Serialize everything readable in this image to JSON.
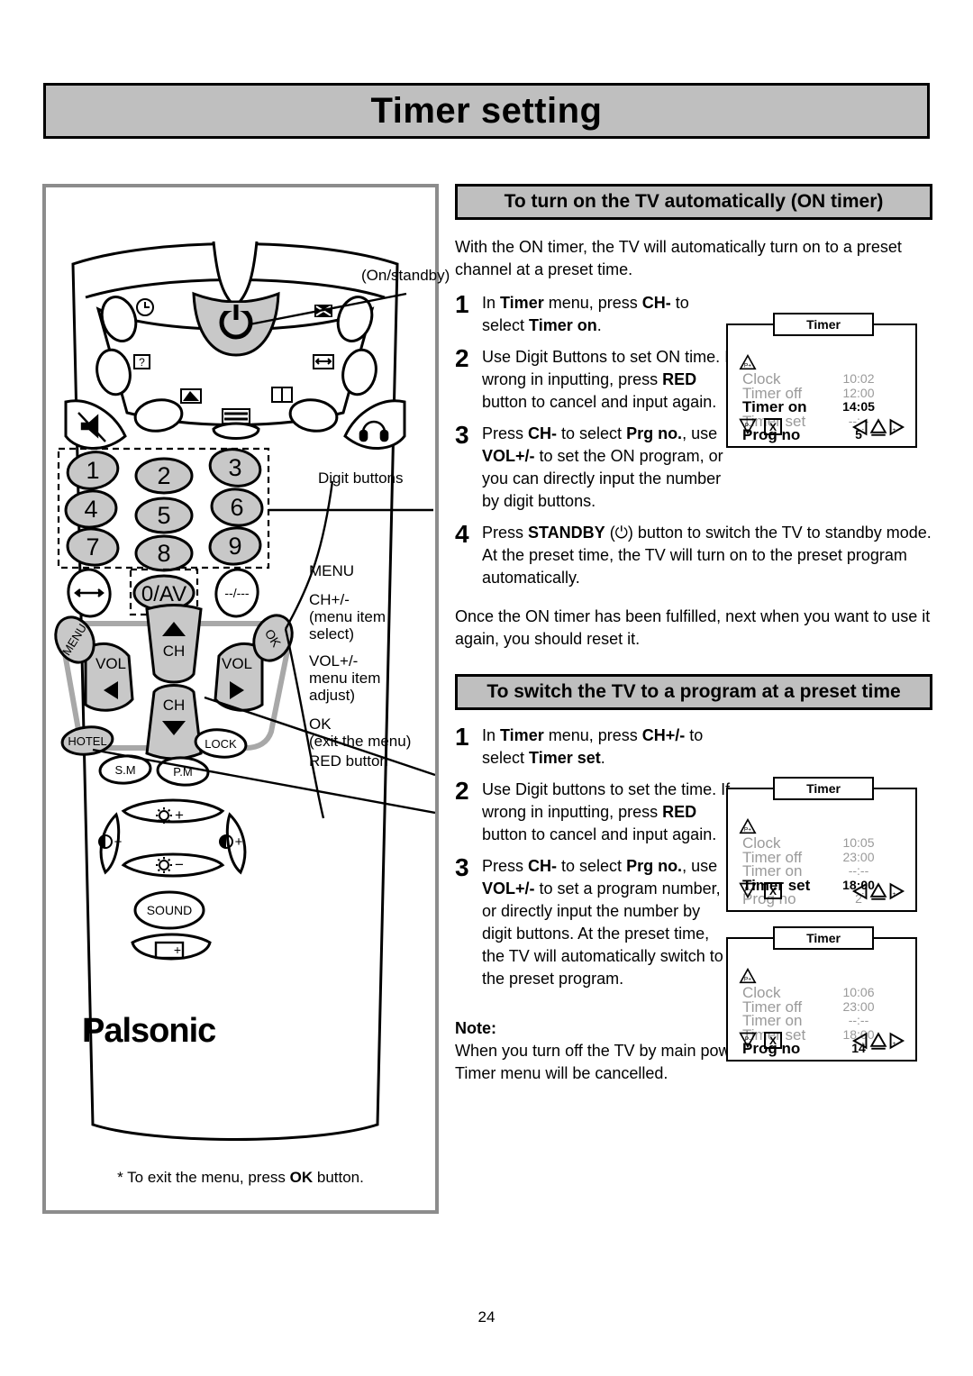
{
  "page": {
    "title": "Timer setting",
    "number": "24"
  },
  "left_panel": {
    "callouts": {
      "on_standby": "(On/standby)",
      "digit_buttons": "Digit buttons",
      "menu": "MENU",
      "ch": "CH+/-",
      "ch_sub": "(menu item",
      "ch_sub2": "select)",
      "vol": "VOL+/-",
      "vol_sub": "menu item",
      "vol_sub2": "adjust)",
      "ok": "OK",
      "ok_sub": "(exit the menu)",
      "red": "RED button"
    },
    "remote": {
      "digits": [
        "1",
        "2",
        "3",
        "4",
        "5",
        "6",
        "7",
        "8",
        "9"
      ],
      "zero_av": "0/AV",
      "prev_channel": "--/---",
      "menu_label": "MENU",
      "ok_label": "OK",
      "ch_up_label": "CH",
      "ch_down_label": "CH",
      "vol_left_label": "VOL",
      "vol_right_label": "VOL",
      "hotel": "HOTEL",
      "lock": "LOCK",
      "sm": "S.M",
      "pm": "P.M",
      "bright_plus": "+",
      "bright_minus": "−",
      "contrast_minus": "−",
      "contrast_plus": "+",
      "sound": "SOUND",
      "brand": "Palsonic"
    },
    "footnote_pre": "* To exit the menu, press ",
    "footnote_bold": "OK",
    "footnote_post": " button."
  },
  "section1": {
    "heading": "To turn on the TV automatically (ON timer)",
    "intro": "With the ON timer, the TV will automatically turn on to a preset channel at a preset time.",
    "steps": [
      {
        "num": "1",
        "parts": [
          {
            "t": "In ",
            "b": false
          },
          {
            "t": "Timer",
            "b": true
          },
          {
            "t": " menu, press ",
            "b": false
          },
          {
            "t": "CH-",
            "b": true
          },
          {
            "t": " to select ",
            "b": false
          },
          {
            "t": "Timer on",
            "b": true
          },
          {
            "t": ".",
            "b": false
          }
        ]
      },
      {
        "num": "2",
        "parts": [
          {
            "t": "Use Digit Buttons to set ON time. If wrong in inputting, press ",
            "b": false
          },
          {
            "t": "RED",
            "b": true
          },
          {
            "t": " button to cancel and input again.",
            "b": false
          }
        ]
      },
      {
        "num": "3",
        "parts": [
          {
            "t": "Press ",
            "b": false
          },
          {
            "t": "CH-",
            "b": true
          },
          {
            "t": " to select ",
            "b": false
          },
          {
            "t": "Prg no.",
            "b": true
          },
          {
            "t": ", use ",
            "b": false
          },
          {
            "t": "VOL+/-",
            "b": true
          },
          {
            "t": " to set the ON program, or you can directly input the number by digit buttons.",
            "b": false
          }
        ]
      },
      {
        "num": "4",
        "wide": true,
        "parts": [
          {
            "t": "Press ",
            "b": false
          },
          {
            "t": "STANDBY",
            "b": true
          },
          {
            "t": " (⏻) button to switch the TV to standby mode.",
            "b": false
          },
          {
            "t": "\nAt the preset time, the TV will turn on to the preset program automatically.",
            "b": false
          }
        ]
      }
    ],
    "outro": "Once the ON timer has been fulfilled, next when you want to use it again, you should reset it.",
    "osd": {
      "title": "Timer",
      "rows": [
        {
          "label": "Clock",
          "value": "10:02",
          "active": false
        },
        {
          "label": "Timer off",
          "value": "12:00",
          "active": false
        },
        {
          "label": "Timer on",
          "value": "14:05",
          "active": true
        },
        {
          "label": "Timer set",
          "value": "--:--",
          "active": false
        },
        {
          "label": "Prog no",
          "value": "5",
          "active": true
        }
      ],
      "up_icon": "P+",
      "down_icon": "P-",
      "exit_icon": "X"
    }
  },
  "section2": {
    "heading": "To switch the TV to a program at a preset time",
    "steps": [
      {
        "num": "1",
        "parts": [
          {
            "t": "In ",
            "b": false
          },
          {
            "t": "Timer",
            "b": true
          },
          {
            "t": " menu, press ",
            "b": false
          },
          {
            "t": "CH+/-",
            "b": true
          },
          {
            "t": " to select ",
            "b": false
          },
          {
            "t": "Timer set",
            "b": true
          },
          {
            "t": ".",
            "b": false
          }
        ]
      },
      {
        "num": "2",
        "parts": [
          {
            "t": "Use Digit buttons to set the time. If wrong in inputting, press ",
            "b": false
          },
          {
            "t": "RED",
            "b": true
          },
          {
            "t": " button to cancel and input again.",
            "b": false
          }
        ]
      },
      {
        "num": "3",
        "parts": [
          {
            "t": "Press ",
            "b": false
          },
          {
            "t": "CH-",
            "b": true
          },
          {
            "t": " to select ",
            "b": false
          },
          {
            "t": "Prg no.",
            "b": true
          },
          {
            "t": ", use ",
            "b": false
          },
          {
            "t": "VOL+/-",
            "b": true
          },
          {
            "t": " to set a program number, or directly input the number by digit buttons. At the preset time, the TV will automatically switch to the preset program.",
            "b": false
          }
        ]
      }
    ],
    "osd_a": {
      "title": "Timer",
      "rows": [
        {
          "label": "Clock",
          "value": "10:05",
          "active": false
        },
        {
          "label": "Timer off",
          "value": "23:00",
          "active": false
        },
        {
          "label": "Timer on",
          "value": "--:--",
          "active": false
        },
        {
          "label": "Timer set",
          "value": "18:00",
          "active": true
        },
        {
          "label": "Prog no",
          "value": "2",
          "active": false
        }
      ],
      "up_icon": "P+",
      "down_icon": "P-",
      "exit_icon": "X"
    },
    "osd_b": {
      "title": "Timer",
      "rows": [
        {
          "label": "Clock",
          "value": "10:06",
          "active": false
        },
        {
          "label": "Timer off",
          "value": "23:00",
          "active": false
        },
        {
          "label": "Timer on",
          "value": "--:--",
          "active": false
        },
        {
          "label": "Timer set",
          "value": "18:00",
          "active": false
        },
        {
          "label": "Prog no",
          "value": "14",
          "active": true
        }
      ],
      "up_icon": "P+",
      "down_icon": "P-",
      "exit_icon": "X"
    }
  },
  "note": {
    "label": "Note:",
    "text": "When you turn off the TV by main power switch, all functions in Timer menu will be cancelled."
  },
  "colors": {
    "header_gray": "#bfbfbf",
    "panel_border": "#8c8c8c",
    "osd_dim": "#9a9a9a",
    "button_gray": "#c8c8c8"
  }
}
